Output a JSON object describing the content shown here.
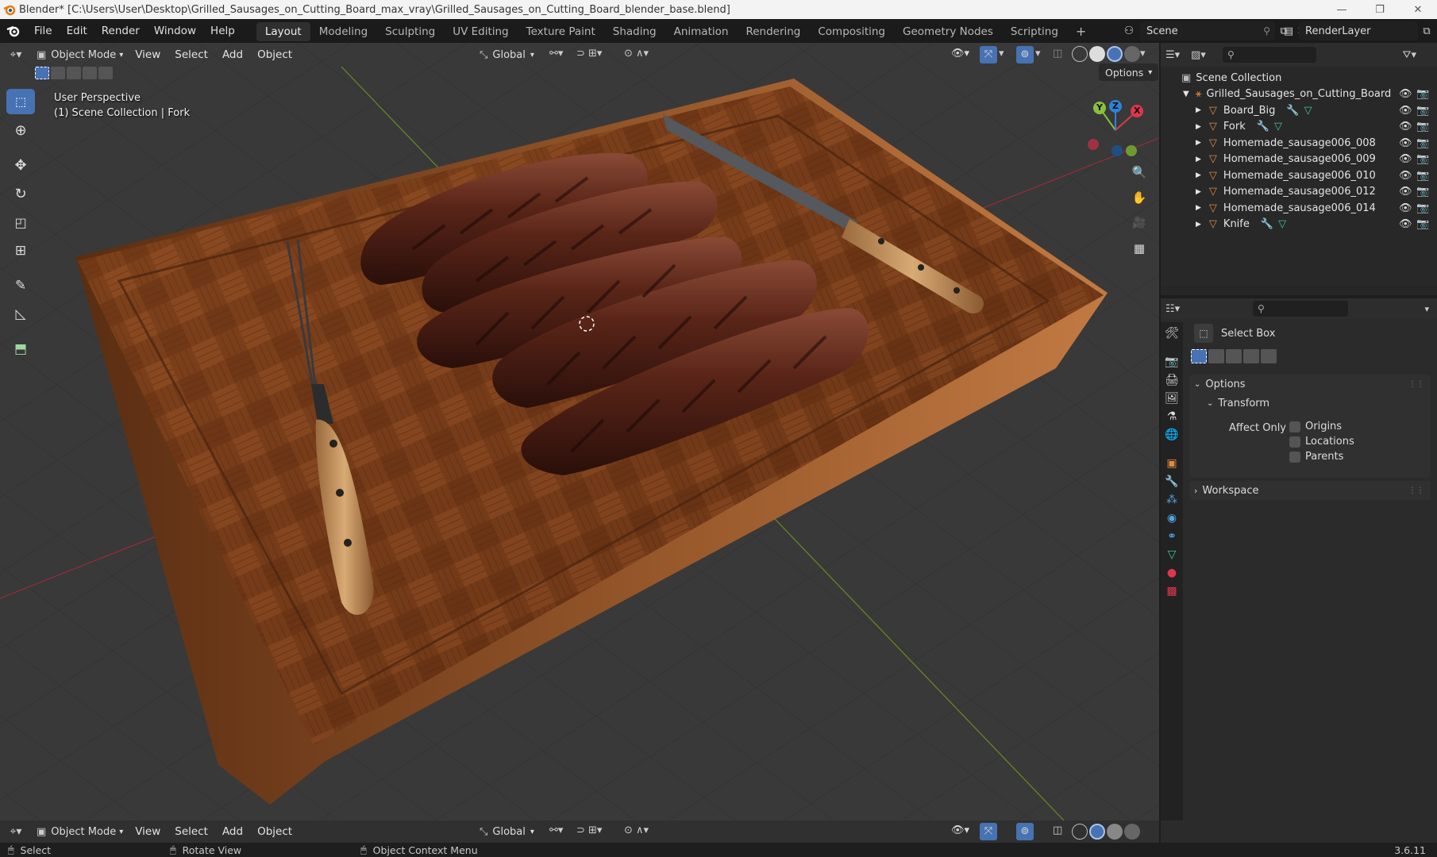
{
  "window": {
    "title": "Blender* [C:\\Users\\User\\Desktop\\Grilled_Sausages_on_Cutting_Board_max_vray\\Grilled_Sausages_on_Cutting_Board_blender_base.blend]",
    "controls": [
      "—",
      "❐",
      "✕"
    ]
  },
  "topmenu": {
    "items": [
      "File",
      "Edit",
      "Render",
      "Window",
      "Help"
    ],
    "workspaces": [
      "Layout",
      "Modeling",
      "Sculpting",
      "UV Editing",
      "Texture Paint",
      "Shading",
      "Animation",
      "Rendering",
      "Compositing",
      "Geometry Nodes",
      "Scripting"
    ],
    "active_workspace": "Layout",
    "add_workspace": "+",
    "scene": "Scene",
    "view_layer": "RenderLayer"
  },
  "viewport": {
    "mode": "Object Mode",
    "menus": [
      "View",
      "Select",
      "Add",
      "Object"
    ],
    "orientation": "Global",
    "options_label": "Options",
    "perspective": "User Perspective",
    "collection_info": "(1) Scene Collection | Fork",
    "gizmo_axes": [
      "X",
      "Y",
      "Z"
    ]
  },
  "outliner": {
    "root": "Scene Collection",
    "collection": "Grilled_Sausages_on_Cutting_Board",
    "objects": [
      {
        "name": "Board_Big",
        "modifiers": true
      },
      {
        "name": "Fork",
        "modifiers": true
      },
      {
        "name": "Homemade_sausage006_008",
        "modifiers": false
      },
      {
        "name": "Homemade_sausage006_009",
        "modifiers": false
      },
      {
        "name": "Homemade_sausage006_010",
        "modifiers": false
      },
      {
        "name": "Homemade_sausage006_012",
        "modifiers": false
      },
      {
        "name": "Homemade_sausage006_014",
        "modifiers": false
      },
      {
        "name": "Knife",
        "modifiers": true
      }
    ]
  },
  "properties": {
    "tool_name": "Select Box",
    "options_header": "Options",
    "transform_header": "Transform",
    "affect_only_label": "Affect Only",
    "checkboxes": [
      "Origins",
      "Locations",
      "Parents"
    ],
    "workspace_header": "Workspace"
  },
  "bottom_header": {
    "mode": "Object Mode",
    "menus": [
      "View",
      "Select",
      "Add",
      "Object"
    ],
    "orientation": "Global"
  },
  "statusbar": {
    "select": "Select",
    "rotate": "Rotate View",
    "context": "Object Context Menu",
    "version": "3.6.11"
  },
  "colors": {
    "accent": "#4772b3",
    "axis_x": "#e0364b",
    "axis_y": "#8ac13c",
    "axis_z": "#2e83d8",
    "object_icon": "#e48a3c",
    "modifier_icon": "#4fa6e6",
    "mesh_icon": "#3fc59a"
  }
}
